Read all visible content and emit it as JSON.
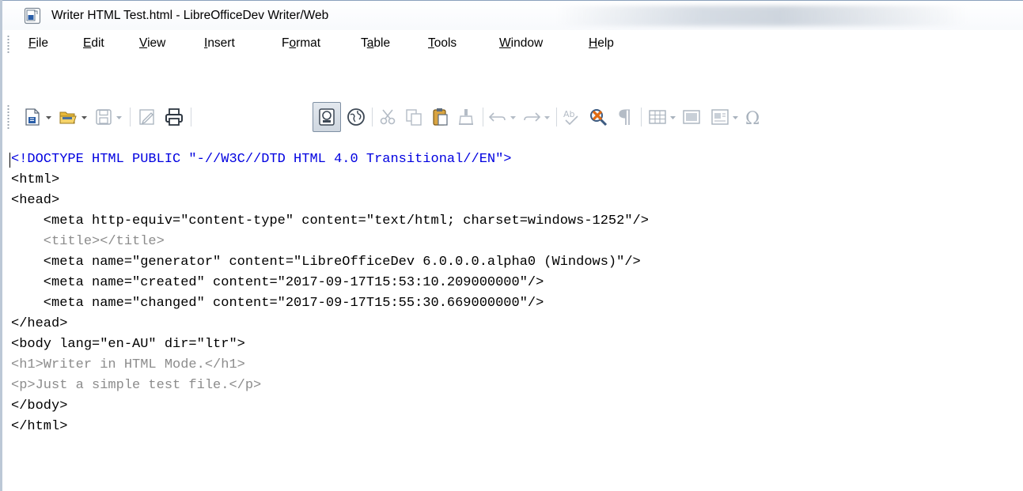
{
  "window": {
    "title": "Writer HTML Test.html - LibreOfficeDev Writer/Web"
  },
  "menu": {
    "items": [
      {
        "label": "File",
        "mnemonic": "F",
        "rest": "ile"
      },
      {
        "label": "Edit",
        "mnemonic": "E",
        "rest": "dit"
      },
      {
        "label": "View",
        "mnemonic": "V",
        "rest": "iew"
      },
      {
        "label": "Insert",
        "mnemonic": "I",
        "rest": "nsert"
      },
      {
        "label": "Format",
        "pre": "F",
        "mnemonic": "o",
        "rest": "rmat"
      },
      {
        "label": "Table",
        "pre": "T",
        "mnemonic": "a",
        "rest": "ble"
      },
      {
        "label": "Tools",
        "mnemonic": "T",
        "rest": "ools"
      },
      {
        "label": "Window",
        "mnemonic": "W",
        "rest": "indow"
      },
      {
        "label": "Help",
        "mnemonic": "H",
        "rest": "elp"
      }
    ]
  },
  "toolbar": {
    "icons": [
      "new-document-icon",
      "open-folder-icon",
      "save-icon",
      "edit-document-icon",
      "print-icon",
      "html-source-icon",
      "web-browser-icon",
      "cut-icon",
      "copy-icon",
      "paste-icon",
      "clone-formatting-icon",
      "undo-icon",
      "redo-icon",
      "spelling-icon",
      "auto-spellcheck-icon",
      "formatting-marks-icon",
      "insert-table-icon",
      "insert-image-icon",
      "insert-text-frame-icon",
      "special-character-icon"
    ],
    "colors": {
      "doc_blue": "#2a5ea8",
      "folder_yellow": "#e8b93a",
      "gray_disabled": "#b4bcc6",
      "active_border": "#7e8fa3"
    }
  },
  "source": {
    "lines": [
      {
        "text": "<!DOCTYPE HTML PUBLIC \"-//W3C//DTD HTML 4.0 Transitional//EN\">",
        "color": "blue"
      },
      {
        "text": "<html>",
        "color": "black"
      },
      {
        "text": "<head>",
        "color": "black"
      },
      {
        "text": "    <meta http-equiv=\"content-type\" content=\"text/html; charset=windows-1252\"/>",
        "color": "black"
      },
      {
        "text": "    <title></title>",
        "color": "gray"
      },
      {
        "text": "    <meta name=\"generator\" content=\"LibreOfficeDev 6.0.0.0.alpha0 (Windows)\"/>",
        "color": "black"
      },
      {
        "text": "    <meta name=\"created\" content=\"2017-09-17T15:53:10.209000000\"/>",
        "color": "black"
      },
      {
        "text": "    <meta name=\"changed\" content=\"2017-09-17T15:55:30.669000000\"/>",
        "color": "black"
      },
      {
        "text": "</head>",
        "color": "black"
      },
      {
        "text": "<body lang=\"en-AU\" dir=\"ltr\">",
        "color": "black"
      },
      {
        "text": "<h1>Writer in HTML Mode.</h1>",
        "color": "gray"
      },
      {
        "text": "<p>Just a simple test file.</p>",
        "color": "gray"
      },
      {
        "text": "</body>",
        "color": "black"
      },
      {
        "text": "</html>",
        "color": "black"
      }
    ],
    "colors": {
      "blue": "#0000e0",
      "black": "#000000",
      "gray": "#8c8c8c"
    }
  }
}
